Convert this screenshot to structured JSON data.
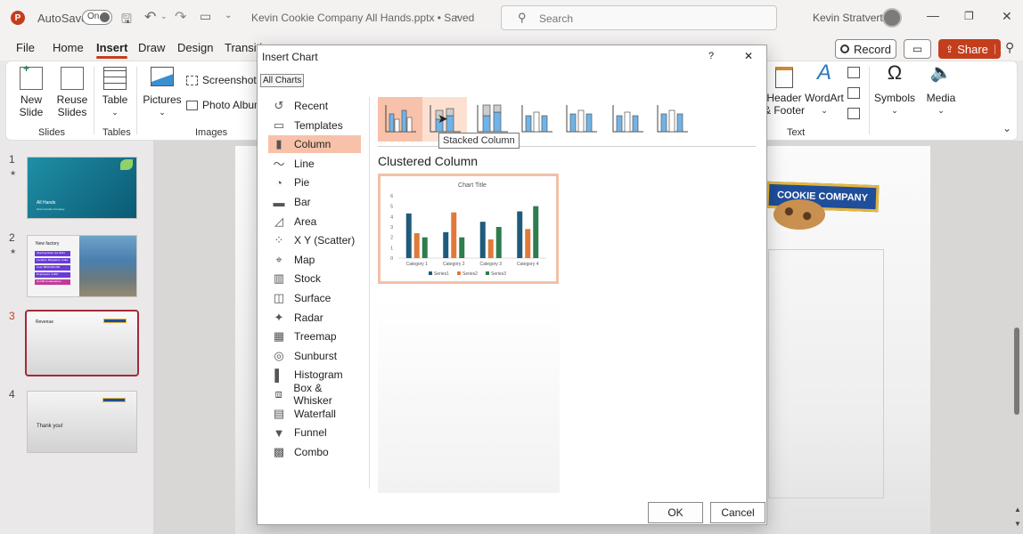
{
  "titlebar": {
    "app_logo": "P",
    "autosave_label": "AutoSave",
    "autosave_state": "On",
    "document_title": "Kevin Cookie Company All Hands.pptx • Saved",
    "search_placeholder": "Search",
    "user_name": "Kevin Stratvert"
  },
  "menu": {
    "tabs": [
      "File",
      "Home",
      "Insert",
      "Draw",
      "Design",
      "Transiti"
    ],
    "active": "Insert",
    "record_label": "Record",
    "share_label": "Share"
  },
  "ribbon": {
    "new_slide": "New\nSlide",
    "reuse_slides": "Reuse\nSlides",
    "table": "Table",
    "pictures": "Pictures",
    "screenshot": "Screenshot",
    "photo_album": "Photo Album",
    "header_footer": "Header\n& Footer",
    "wordart": "WordArt",
    "symbols": "Symbols",
    "media": "Media",
    "groups": {
      "slides": "Slides",
      "tables": "Tables",
      "images": "Images",
      "text": "Text"
    }
  },
  "slides": [
    {
      "num": "1",
      "title": "All Hands",
      "subtitle": "Kevin Cookie Company"
    },
    {
      "num": "2",
      "title": "New factory",
      "items": [
        "Opening Date: Q1 2024",
        "Location: Bangalore, India",
        "Cost: $500,000,000",
        "Employees: 3,000",
        "10,000 Cookies/hour"
      ]
    },
    {
      "num": "3",
      "title": "Revenue"
    },
    {
      "num": "4",
      "title": "Thank you!"
    }
  ],
  "canvas_banner": "COOKIE COMPANY",
  "dialog": {
    "title": "Insert Chart",
    "help": "?",
    "close": "✕",
    "all_charts_tab": "All Charts",
    "categories": [
      "Recent",
      "Templates",
      "Column",
      "Line",
      "Pie",
      "Bar",
      "Area",
      "X Y (Scatter)",
      "Map",
      "Stock",
      "Surface",
      "Radar",
      "Treemap",
      "Sunburst",
      "Histogram",
      "Box & Whisker",
      "Waterfall",
      "Funnel",
      "Combo"
    ],
    "selected_category": "Column",
    "subtype_icons": [
      "clustered-column-icon",
      "stacked-column-icon",
      "100-stacked-column-icon",
      "3d-clustered-column-icon",
      "3d-stacked-column-icon",
      "3d-100-stacked-column-icon",
      "3d-column-icon"
    ],
    "tooltip": "Stacked Column",
    "preview_heading": "Clustered Column",
    "ok": "OK",
    "cancel": "Cancel"
  },
  "chart_data": {
    "type": "bar",
    "title": "Chart Title",
    "categories": [
      "Category 1",
      "Category 2",
      "Category 3",
      "Category 4"
    ],
    "series": [
      {
        "name": "Series1",
        "values": [
          4.3,
          2.5,
          3.5,
          4.5
        ],
        "color": "#1f5b7a"
      },
      {
        "name": "Series2",
        "values": [
          2.4,
          4.4,
          1.8,
          2.8
        ],
        "color": "#e07a3a"
      },
      {
        "name": "Series3",
        "values": [
          2,
          2,
          3,
          5
        ],
        "color": "#2e7d4f"
      }
    ],
    "ylim": [
      0,
      6
    ],
    "yticks": [
      "0",
      "1",
      "2",
      "3",
      "4",
      "5",
      "6"
    ],
    "legend": "bottom",
    "grid": false
  }
}
